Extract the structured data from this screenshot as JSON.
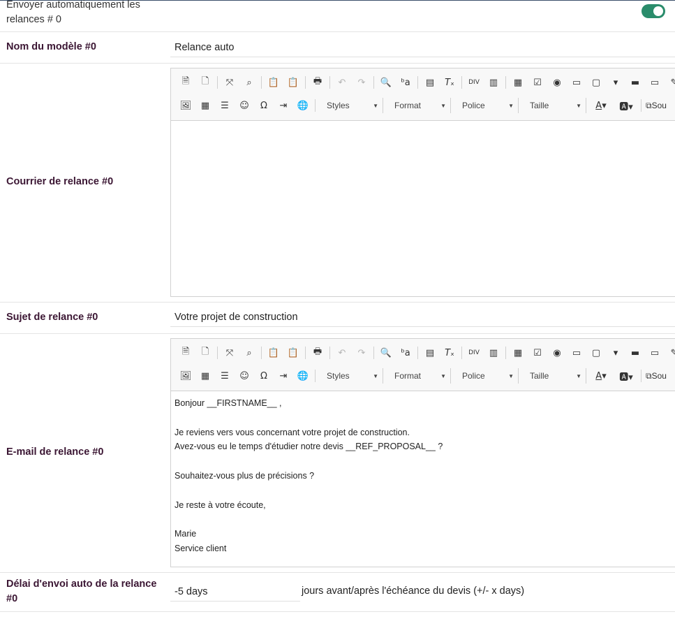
{
  "auto_send": {
    "label": "Envoyer automatiquement les relances # 0",
    "enabled": true
  },
  "model_name": {
    "label": "Nom du modèle #0",
    "value": "Relance auto"
  },
  "letter": {
    "label": "Courrier de relance #0",
    "content": []
  },
  "subject": {
    "label": "Sujet de relance #0",
    "value": "Votre projet de construction"
  },
  "email": {
    "label": "E-mail de relance #0",
    "content": [
      "Bonjour __FIRSTNAME__ ,",
      "",
      "Je reviens vers vous concernant votre projet de construction.",
      "Avez-vous eu le temps d'étudier notre devis __REF_PROPOSAL__ ?",
      "",
      "Souhaitez-vous plus de précisions ?",
      "",
      "Je reste à votre écoute,",
      "",
      "Marie",
      "Service client"
    ]
  },
  "delay": {
    "label": "Délai d'envoi auto de la relance #0",
    "value": "-5 days",
    "suffix": "jours avant/après l'échéance du devis (+/- x days)"
  },
  "toolbar": {
    "combos": {
      "styles": "Styles",
      "format": "Format",
      "font": "Police",
      "size": "Taille"
    },
    "source_label": "Sou",
    "icons": [
      "new-page",
      "preview",
      "maximize",
      "show-blocks",
      "paste",
      "paste-word",
      "print",
      "undo",
      "redo",
      "find",
      "replace",
      "select-all",
      "remove-format",
      "create-div",
      "iframe",
      "form",
      "checkbox",
      "radio",
      "text-field",
      "textarea",
      "select",
      "button",
      "image-button",
      "hidden-field",
      "image",
      "table",
      "horizontal-rule",
      "smiley",
      "special-char",
      "page-break",
      "link",
      "text-color",
      "bg-color",
      "source"
    ]
  },
  "colors": {
    "toggle": "#2a8c6b",
    "label": "#3b1633"
  }
}
